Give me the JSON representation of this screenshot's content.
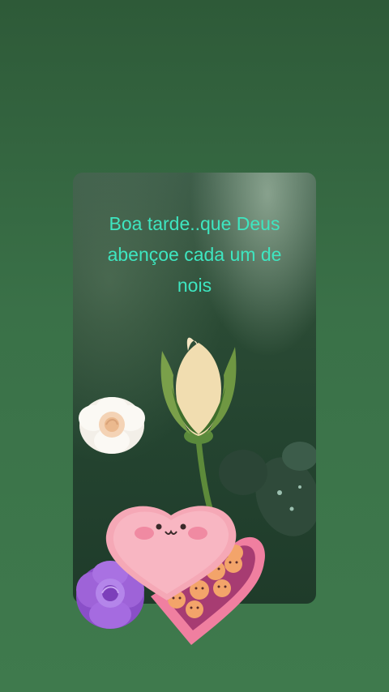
{
  "post": {
    "greeting": "Boa tarde..que Deus\nabençoe cada um de\nnois"
  },
  "colors": {
    "background": "#3a7148",
    "greeting_text": "#3ee6c0",
    "card": "#2a4a34"
  },
  "icons": {
    "bud": "rose-bud-icon",
    "white_rose": "white-rose-icon",
    "purple_rose": "purple-rose-icon",
    "heart_box": "heart-chocolate-box-icon"
  }
}
